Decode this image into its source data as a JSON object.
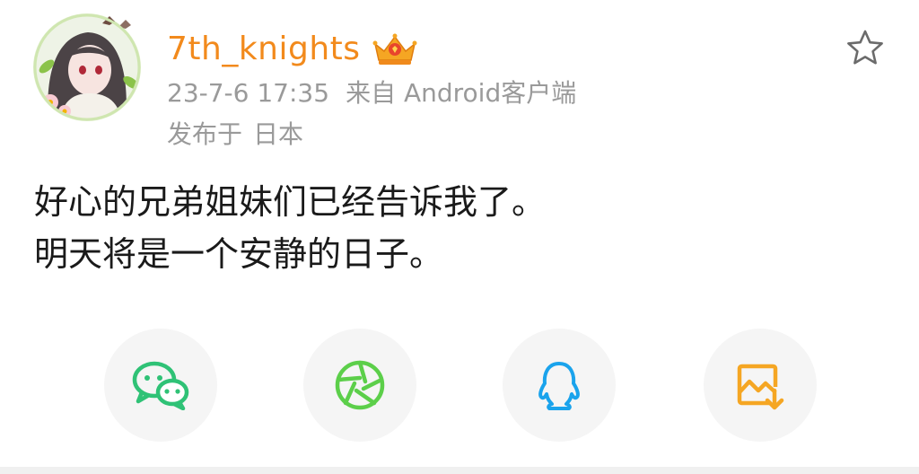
{
  "post": {
    "username": "7th_knights",
    "timestamp": "23-7-6 17:35",
    "source": "来自 Android客户端",
    "location_prefix": "发布于",
    "location": "日本",
    "content_line1": "好心的兄弟姐妹们已经告诉我了。",
    "content_line2": "明天将是一个安静的日子。"
  },
  "icons": {
    "avatar": "avatar-image",
    "badge": "crown-badge-icon",
    "favorite": "star-icon",
    "share_buttons": [
      "wechat-icon",
      "moments-icon",
      "qq-icon",
      "save-image-icon"
    ]
  },
  "colors": {
    "username": "#f28a1c",
    "meta": "#9a9a9a",
    "wechat": "#2fc276",
    "moments": "#5ccf4a",
    "qq": "#1aa3ec",
    "save": "#f5a623"
  }
}
